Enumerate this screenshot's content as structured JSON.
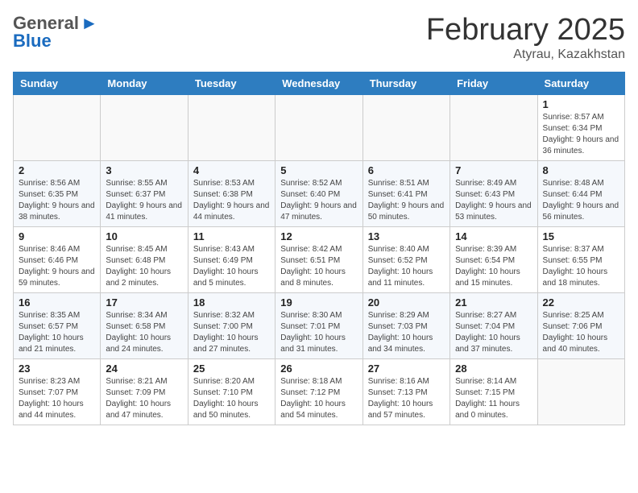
{
  "header": {
    "logo_general": "General",
    "logo_blue": "Blue",
    "month_title": "February 2025",
    "location": "Atyrau, Kazakhstan"
  },
  "days_of_week": [
    "Sunday",
    "Monday",
    "Tuesday",
    "Wednesday",
    "Thursday",
    "Friday",
    "Saturday"
  ],
  "weeks": [
    [
      {
        "day": "",
        "info": ""
      },
      {
        "day": "",
        "info": ""
      },
      {
        "day": "",
        "info": ""
      },
      {
        "day": "",
        "info": ""
      },
      {
        "day": "",
        "info": ""
      },
      {
        "day": "",
        "info": ""
      },
      {
        "day": "1",
        "info": "Sunrise: 8:57 AM\nSunset: 6:34 PM\nDaylight: 9 hours and 36 minutes."
      }
    ],
    [
      {
        "day": "2",
        "info": "Sunrise: 8:56 AM\nSunset: 6:35 PM\nDaylight: 9 hours and 38 minutes."
      },
      {
        "day": "3",
        "info": "Sunrise: 8:55 AM\nSunset: 6:37 PM\nDaylight: 9 hours and 41 minutes."
      },
      {
        "day": "4",
        "info": "Sunrise: 8:53 AM\nSunset: 6:38 PM\nDaylight: 9 hours and 44 minutes."
      },
      {
        "day": "5",
        "info": "Sunrise: 8:52 AM\nSunset: 6:40 PM\nDaylight: 9 hours and 47 minutes."
      },
      {
        "day": "6",
        "info": "Sunrise: 8:51 AM\nSunset: 6:41 PM\nDaylight: 9 hours and 50 minutes."
      },
      {
        "day": "7",
        "info": "Sunrise: 8:49 AM\nSunset: 6:43 PM\nDaylight: 9 hours and 53 minutes."
      },
      {
        "day": "8",
        "info": "Sunrise: 8:48 AM\nSunset: 6:44 PM\nDaylight: 9 hours and 56 minutes."
      }
    ],
    [
      {
        "day": "9",
        "info": "Sunrise: 8:46 AM\nSunset: 6:46 PM\nDaylight: 9 hours and 59 minutes."
      },
      {
        "day": "10",
        "info": "Sunrise: 8:45 AM\nSunset: 6:48 PM\nDaylight: 10 hours and 2 minutes."
      },
      {
        "day": "11",
        "info": "Sunrise: 8:43 AM\nSunset: 6:49 PM\nDaylight: 10 hours and 5 minutes."
      },
      {
        "day": "12",
        "info": "Sunrise: 8:42 AM\nSunset: 6:51 PM\nDaylight: 10 hours and 8 minutes."
      },
      {
        "day": "13",
        "info": "Sunrise: 8:40 AM\nSunset: 6:52 PM\nDaylight: 10 hours and 11 minutes."
      },
      {
        "day": "14",
        "info": "Sunrise: 8:39 AM\nSunset: 6:54 PM\nDaylight: 10 hours and 15 minutes."
      },
      {
        "day": "15",
        "info": "Sunrise: 8:37 AM\nSunset: 6:55 PM\nDaylight: 10 hours and 18 minutes."
      }
    ],
    [
      {
        "day": "16",
        "info": "Sunrise: 8:35 AM\nSunset: 6:57 PM\nDaylight: 10 hours and 21 minutes."
      },
      {
        "day": "17",
        "info": "Sunrise: 8:34 AM\nSunset: 6:58 PM\nDaylight: 10 hours and 24 minutes."
      },
      {
        "day": "18",
        "info": "Sunrise: 8:32 AM\nSunset: 7:00 PM\nDaylight: 10 hours and 27 minutes."
      },
      {
        "day": "19",
        "info": "Sunrise: 8:30 AM\nSunset: 7:01 PM\nDaylight: 10 hours and 31 minutes."
      },
      {
        "day": "20",
        "info": "Sunrise: 8:29 AM\nSunset: 7:03 PM\nDaylight: 10 hours and 34 minutes."
      },
      {
        "day": "21",
        "info": "Sunrise: 8:27 AM\nSunset: 7:04 PM\nDaylight: 10 hours and 37 minutes."
      },
      {
        "day": "22",
        "info": "Sunrise: 8:25 AM\nSunset: 7:06 PM\nDaylight: 10 hours and 40 minutes."
      }
    ],
    [
      {
        "day": "23",
        "info": "Sunrise: 8:23 AM\nSunset: 7:07 PM\nDaylight: 10 hours and 44 minutes."
      },
      {
        "day": "24",
        "info": "Sunrise: 8:21 AM\nSunset: 7:09 PM\nDaylight: 10 hours and 47 minutes."
      },
      {
        "day": "25",
        "info": "Sunrise: 8:20 AM\nSunset: 7:10 PM\nDaylight: 10 hours and 50 minutes."
      },
      {
        "day": "26",
        "info": "Sunrise: 8:18 AM\nSunset: 7:12 PM\nDaylight: 10 hours and 54 minutes."
      },
      {
        "day": "27",
        "info": "Sunrise: 8:16 AM\nSunset: 7:13 PM\nDaylight: 10 hours and 57 minutes."
      },
      {
        "day": "28",
        "info": "Sunrise: 8:14 AM\nSunset: 7:15 PM\nDaylight: 11 hours and 0 minutes."
      },
      {
        "day": "",
        "info": ""
      }
    ]
  ]
}
